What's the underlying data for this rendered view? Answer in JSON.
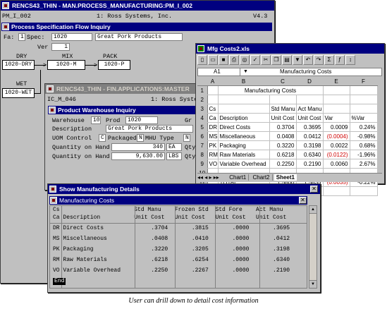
{
  "win_main": {
    "title": "RENCS43_THIN - MAN.PROCESS_MANUFACTURING:PM_I_002",
    "screen_id": "PM_I_002",
    "company": "1: Ross Systems, Inc.",
    "version": "V4.3",
    "inner_title": "Process Specification Flow Inquiry",
    "fa_label": "Fa:",
    "fa_value": "1",
    "spec_label": "Spec:",
    "spec_value": "1020",
    "spec_desc": "Great Pork Products",
    "ver_label": "Ver",
    "ver_value": "1",
    "flow": {
      "dry_label": "DRY",
      "dry_box": "1020-DRY",
      "mix_label": "MIX",
      "mix_box": "1020-M",
      "pack_label": "PACK",
      "pack_box": "1020-P",
      "wet_label": "WET",
      "wet_box": "1020-WET"
    }
  },
  "win_fin": {
    "title": "RENCS43_THIN - FIN.APPLICATIONS:MASTER",
    "screen_id": "IC_M_046",
    "company": "1: Ross Systems",
    "inner_title": "Product Warehouse Inquiry",
    "warehouse_label": "Warehouse",
    "warehouse_value": "10",
    "prod_label": "Prod",
    "prod_value": "1020",
    "gr_label": "Gr",
    "desc_label": "Description",
    "desc_value": "Great Pork Products",
    "uom_label": "UOM Control",
    "uom_value": "C",
    "packaged_label": "Packaged",
    "packaged_value": "N",
    "mhu_label": "MHU Type",
    "mhu_value": "N",
    "qty1_label": "Quantity on Hand",
    "qty1_value": "340",
    "qty1_uom": "EA",
    "qty1_suffix": "Qty",
    "qty2_label": "Quantity on Hand",
    "qty2_value": "9,630.00",
    "qty2_uom": "LBS",
    "qty2_suffix": "Qty"
  },
  "win_xls": {
    "title": "Mfg Costs2.xls",
    "cell_ref": "A1",
    "formula": "Manufacturing Costs",
    "col_headers": [
      "A",
      "B",
      "C",
      "D",
      "E",
      "F"
    ],
    "rows": [
      {
        "n": "1",
        "a": "",
        "b": "Manufacturing Costs",
        "c": "",
        "d": "",
        "e": "",
        "f": "",
        "red_e": false
      },
      {
        "n": "2",
        "a": "",
        "b": "",
        "c": "",
        "d": "",
        "e": "",
        "f": "",
        "red_e": false
      },
      {
        "n": "3",
        "a": "Cs",
        "b": "",
        "c": "Std Manu",
        "d": "Act Manu",
        "e": "",
        "f": "",
        "red_e": false
      },
      {
        "n": "4",
        "a": "Ca",
        "b": "Description",
        "c": "Unit Cost",
        "d": "Unit Cost",
        "e": "Var",
        "f": "%Var",
        "red_e": false
      },
      {
        "n": "5",
        "a": "DR",
        "b": "Direct Costs",
        "c": "0.3704",
        "d": "0.3695",
        "e": "0.0009",
        "f": "0.24%",
        "red_e": false
      },
      {
        "n": "6",
        "a": "MS",
        "b": "Miscellaneous",
        "c": "0.0408",
        "d": "0.0412",
        "e": "(0.0004)",
        "f": "-0.98%",
        "red_e": true
      },
      {
        "n": "7",
        "a": "PK",
        "b": "Packaging",
        "c": "0.3220",
        "d": "0.3198",
        "e": "0.0022",
        "f": "0.68%",
        "red_e": false
      },
      {
        "n": "8",
        "a": "RM",
        "b": "Raw Materials",
        "c": "0.6218",
        "d": "0.6340",
        "e": "(0.0122)",
        "f": "-1.96%",
        "red_e": true
      },
      {
        "n": "9",
        "a": "VO",
        "b": "Variable Overhead",
        "c": "0.2250",
        "d": "0.2190",
        "e": "0.0060",
        "f": "2.67%",
        "red_e": false
      },
      {
        "n": "10",
        "a": "",
        "b": "",
        "c": "",
        "d": "",
        "e": "",
        "f": "",
        "red_e": false
      },
      {
        "n": "11",
        "a": "",
        "b": "TOTAL",
        "c": "1.5800",
        "d": "1.5835",
        "e": "(0.0035)",
        "f": "-0.22%",
        "red_e": true
      },
      {
        "n": "12",
        "a": "",
        "b": "",
        "c": "",
        "d": "",
        "e": "",
        "f": "",
        "red_e": false
      }
    ],
    "sheet_tabs": [
      "Chart1",
      "Chart2",
      "Sheet1"
    ],
    "active_sheet": "Sheet1"
  },
  "win_details": {
    "title": "Show Manufacturing Details",
    "inner_title": "Manufacturing Costs",
    "header_line1": "Cs                      Std Manu    Frozen Std  Std Fore    Act Manu",
    "header_line2": "Ca Description          Unit Cost   Unit Cost   Unit Cost   Unit Cost",
    "rows": [
      "DR Direct Costs              .3704       .3815       .0000       .3695",
      "MS Miscellaneous             .0408       .0410       .0000       .0412",
      "PK Packaging                 .3220       .3205       .0000       .3198",
      "RM Raw Materials             .6218       .6254       .0000       .6340",
      "VO Variable Overhead         .2250       .2267       .0000       .2190"
    ],
    "end_label": "End"
  },
  "caption": "User can drill down to detail cost information"
}
